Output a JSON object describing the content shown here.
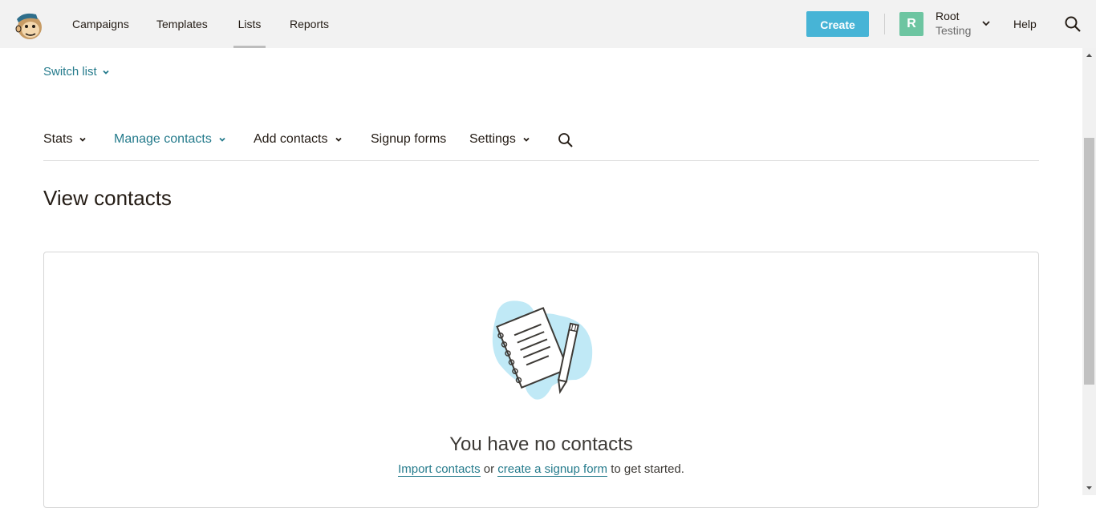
{
  "topbar": {
    "nav": [
      {
        "label": "Campaigns"
      },
      {
        "label": "Templates"
      },
      {
        "label": "Lists",
        "active": true
      },
      {
        "label": "Reports"
      }
    ],
    "create_label": "Create",
    "account": {
      "initial": "R",
      "name": "Root",
      "org": "Testing"
    },
    "help_label": "Help",
    "icons": {
      "logo": "mailchimp-freddie-logo",
      "search": "search-icon",
      "account_menu": "chevron-down-icon"
    }
  },
  "content": {
    "switch_list_label": "Switch list",
    "subnav": [
      {
        "label": "Stats",
        "dropdown": true
      },
      {
        "label": "Manage contacts",
        "dropdown": true,
        "active": true
      },
      {
        "label": "Add contacts",
        "dropdown": true
      },
      {
        "label": "Signup forms",
        "dropdown": false
      },
      {
        "label": "Settings",
        "dropdown": true
      }
    ],
    "page_title": "View contacts",
    "empty_state": {
      "title": "You have no contacts",
      "link1": "Import contacts",
      "mid_text": " or ",
      "link2": "create a signup form",
      "end_text": " to get started."
    }
  },
  "colors": {
    "accent": "#47b4d6",
    "link": "#257b8c",
    "avatar": "#6dc5a1",
    "topbar_bg": "#f2f2f2",
    "illustration_blob": "#c0e9f6"
  }
}
